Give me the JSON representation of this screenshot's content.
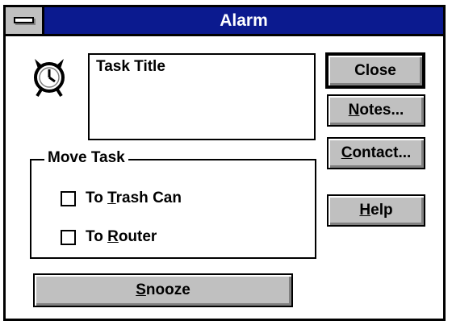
{
  "window": {
    "title": "Alarm"
  },
  "icon": {
    "name": "alarm-clock-icon"
  },
  "task": {
    "title": "Task Title"
  },
  "buttons": {
    "close": "Close",
    "notes_underline": "N",
    "notes_rest": "otes...",
    "contact_underline": "C",
    "contact_rest": "ontact...",
    "help_underline": "H",
    "help_rest": "elp",
    "snooze_underline": "S",
    "snooze_rest": "nooze"
  },
  "move_task": {
    "label": "Move Task",
    "trash_pre": "To ",
    "trash_underline": "T",
    "trash_rest": "rash Can",
    "router_pre": "To ",
    "router_underline": "R",
    "router_rest": "outer",
    "trash_checked": false,
    "router_checked": false
  },
  "colors": {
    "titlebar": "#0b1a8f",
    "button_face": "#c0c0c0"
  }
}
